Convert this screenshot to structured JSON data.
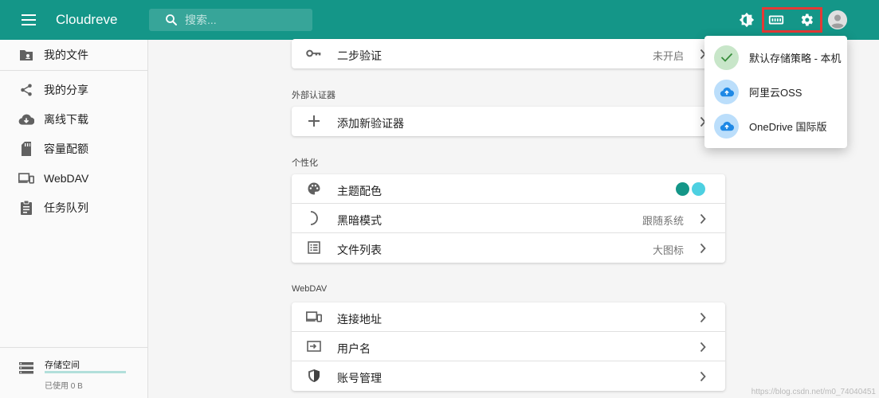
{
  "app": {
    "title": "Cloudreve"
  },
  "search": {
    "placeholder": "搜索..."
  },
  "colors": {
    "primary": "#149688",
    "accent": "#4dd0e1",
    "highlight": "#e53935"
  },
  "topbar": {
    "icons": [
      "menu-icon",
      "search-icon",
      "brightness-icon",
      "storage-policy-icon",
      "settings-icon",
      "account-icon"
    ]
  },
  "sidebar": {
    "items": [
      {
        "label": "我的文件",
        "icon": "folder-icon"
      },
      {
        "label": "我的分享",
        "icon": "share-icon"
      },
      {
        "label": "离线下载",
        "icon": "cloud-download-icon"
      },
      {
        "label": "容量配额",
        "icon": "sd-card-icon"
      },
      {
        "label": "WebDAV",
        "icon": "devices-icon"
      },
      {
        "label": "任务队列",
        "icon": "clipboard-icon"
      }
    ],
    "storage": {
      "title": "存储空间",
      "used": "已使用 0 B",
      "fraction": 0
    }
  },
  "settings": {
    "security": {
      "two_factor": {
        "label": "二步验证",
        "value": "未开启"
      }
    },
    "authenticators": {
      "title": "外部认证器",
      "add": {
        "label": "添加新验证器"
      }
    },
    "personalization": {
      "title": "个性化",
      "theme": {
        "label": "主题配色",
        "swatches": [
          "#149688",
          "#4dd0e1"
        ]
      },
      "dark_mode": {
        "label": "黑暗模式",
        "value": "跟随系统"
      },
      "file_list": {
        "label": "文件列表",
        "value": "大图标"
      }
    },
    "webdav": {
      "title": "WebDAV",
      "address": {
        "label": "连接地址"
      },
      "username": {
        "label": "用户名"
      },
      "accounts": {
        "label": "账号管理"
      }
    }
  },
  "storage_policy_menu": {
    "items": [
      {
        "label": "默认存储策略 - 本机",
        "selected": true
      },
      {
        "label": "阿里云OSS",
        "selected": false
      },
      {
        "label": "OneDrive 国际版",
        "selected": false
      }
    ]
  },
  "watermark": "https://blog.csdn.net/m0_74040451"
}
